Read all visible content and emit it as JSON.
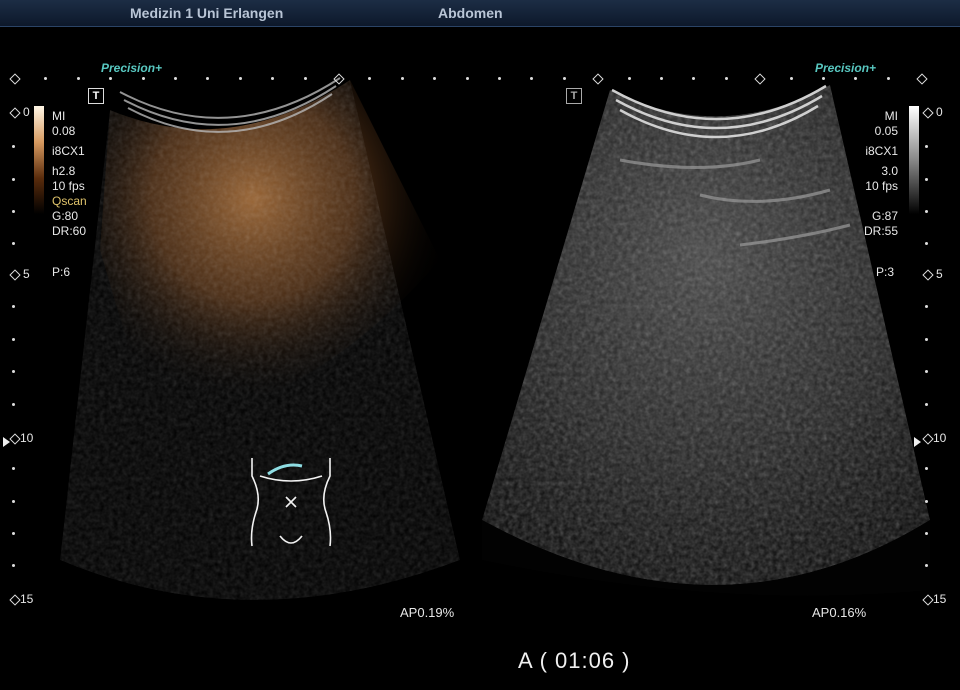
{
  "header": {
    "institution": "Medizin 1 Uni Erlangen",
    "exam": "Abdomen"
  },
  "left_image": {
    "brand": "Precision",
    "brand_mark": "+",
    "trapezoid_icon": "T",
    "params": [
      "MI",
      "0.08",
      "i8CX1",
      "h2.8",
      "10 fps",
      "Qscan",
      "G:80",
      "DR:60"
    ],
    "persistence": "P:6",
    "acoustic_power": "AP0.19%",
    "colormap": "contrast-orange"
  },
  "right_image": {
    "brand": "Precision",
    "brand_mark": "+",
    "trapezoid_icon": "T",
    "params": [
      "MI",
      "0.05",
      "i8CX1",
      "3.0",
      "10 fps",
      "",
      "G:87",
      "DR:55"
    ],
    "persistence": "P:3",
    "acoustic_power": "AP0.16%",
    "colormap": "grayscale"
  },
  "depth_scale": [
    "0",
    "5",
    "10",
    "15"
  ],
  "focus_marker": "focus-arrow-icon",
  "body_marker": {
    "icon": "abdomen-body-marker-icon",
    "probe": "probe-position-icon"
  },
  "timer": "A  ( 01:06 )",
  "colors": {
    "header_bg": "#13233a",
    "brand": "#58c7c0",
    "contrast": "#c98a4b"
  }
}
